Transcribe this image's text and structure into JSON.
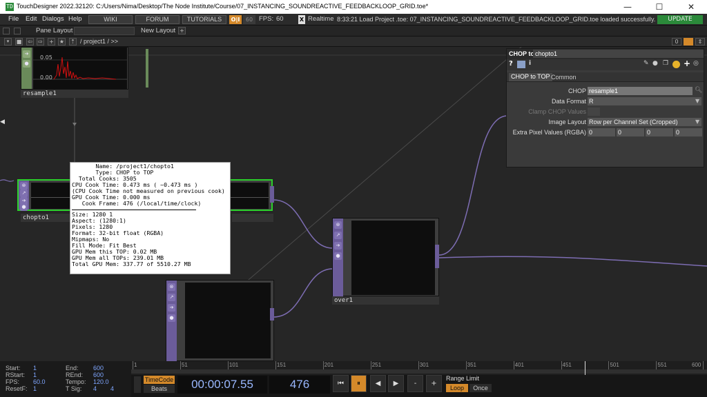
{
  "window": {
    "title": "TouchDesigner 2022.32120: C:/Users/Nima/Desktop/The Node Institute/Course/07_INSTANCING_SOUNDREACTIVE_FEEDBACKLOOP_GRID.toe*",
    "app_icon": "TD",
    "minimize": "—",
    "maximize": "☐",
    "close": "✕"
  },
  "menu": {
    "items": [
      "File",
      "Edit",
      "Dialogs",
      "Help"
    ],
    "wiki": "WIKI",
    "forum": "FORUM",
    "tutorials": "TUTORIALS",
    "oi_badge": "O|I",
    "fps_target": "60",
    "fps_label": "FPS:",
    "fps_value": "60",
    "realtime_check": "X",
    "realtime": "Realtime",
    "log": "8:33:21 Load Project .toe: 07_INSTANCING_SOUNDREACTIVE_FEEDBACKLOOP_GRID.toe loaded successfully.",
    "update": "UPDATE"
  },
  "panebar": {
    "pane_layout": "Pane Layout",
    "new_layout": "New Layout",
    "add": "+"
  },
  "pathbar": {
    "path": "/ project1 / >>",
    "pane_index": "0"
  },
  "nodes": {
    "resample": {
      "name": "resample1",
      "y_ticks": [
        "0.05",
        "0.00"
      ]
    },
    "chopto": {
      "name": "chopto1"
    },
    "over": {
      "name": "over1"
    }
  },
  "info": {
    "lines": [
      "       Name: /project1/chopto1",
      "       Type: CHOP to TOP",
      "  Total Cooks: 3505",
      "CPU Cook Time: 0.473 ms ( ~0.473 ms )",
      "(CPU Cook Time not measured on previous cook)",
      "GPU Cook Time: 0.000 ms",
      "   Cook Frame: 476 (/local/time/clock)",
      "Size: 1280 1",
      "Aspect: (1280:1)",
      "Pixels: 1280",
      "Format: 32-bit float (RGBA)",
      "Mipmaps: No",
      "Fill Mode: Fit Best",
      "GPU Mem this TOP: 0.02 MB",
      "GPU Mem all TOPs: 239.01 MB",
      "Total GPU Mem: 337.77 of 5510.27 MB"
    ]
  },
  "params": {
    "header_type": "CHOP to",
    "header_name": "chopto1",
    "tabs": [
      "CHOP to TOP",
      "Common"
    ],
    "rows": [
      {
        "label": "CHOP",
        "value": "resample1"
      },
      {
        "label": "Data Format",
        "value": "R"
      },
      {
        "label": "Clamp CHOP Values",
        "value": ""
      },
      {
        "label": "Image Layout",
        "value": "Row per Channel Set (Cropped)"
      },
      {
        "label": "Extra Pixel Values (RGBA)",
        "value": ""
      }
    ],
    "rgba": [
      "0",
      "0",
      "0",
      "0"
    ]
  },
  "timeline": {
    "ticks": [
      "1",
      "51",
      "101",
      "151",
      "201",
      "251",
      "301",
      "351",
      "401",
      "451",
      "501",
      "551",
      "600"
    ],
    "stats": {
      "start_label": "Start:",
      "start": "1",
      "rstart_label": "RStart:",
      "rstart": "1",
      "fps_label": "FPS:",
      "fps": "60.0",
      "resetf_label": "ResetF:",
      "resetf": "1",
      "end_label": "End:",
      "end": "600",
      "rend_label": "REnd:",
      "rend": "600",
      "tempo_label": "Tempo:",
      "tempo": "120.0",
      "tsig_label": "T Sig:",
      "tsig_a": "4",
      "tsig_b": "4"
    },
    "timecode_label": "TimeCode",
    "beats_label": "Beats",
    "timecode": "00:00:07.55",
    "frame": "476",
    "range_limit": "Range Limit",
    "loop": "Loop",
    "once": "Once",
    "current_frame": 476,
    "total_frames": 600
  }
}
